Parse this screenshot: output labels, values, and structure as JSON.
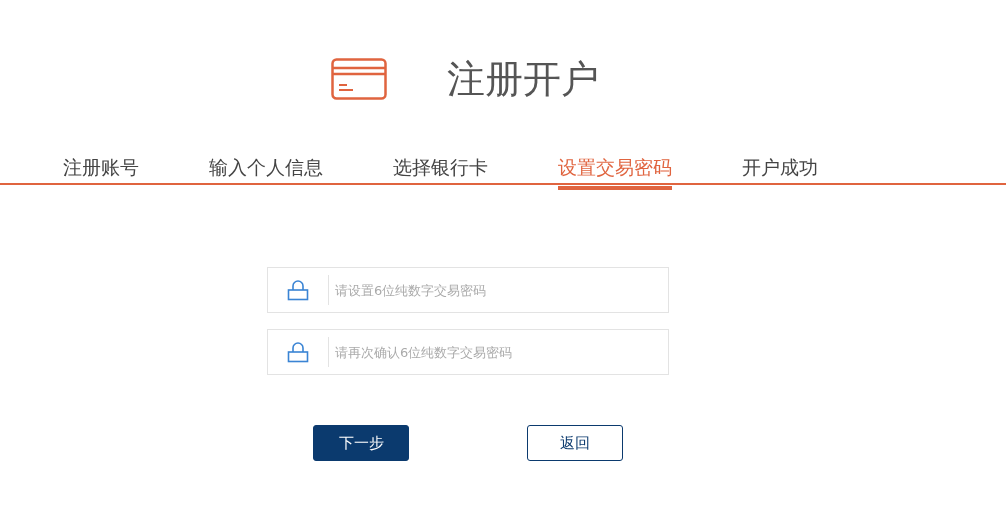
{
  "header": {
    "title": "注册开户"
  },
  "steps": [
    {
      "label": "注册账号",
      "selected": false
    },
    {
      "label": "输入个人信息",
      "selected": false
    },
    {
      "label": "选择银行卡",
      "selected": false
    },
    {
      "label": "设置交易密码",
      "selected": true
    },
    {
      "label": "开户成功",
      "selected": false
    }
  ],
  "fields": [
    {
      "placeholder": "请设置6位纯数字交易密码"
    },
    {
      "placeholder": "请再次确认6位纯数字交易密码"
    }
  ],
  "buttons": [
    {
      "label": "下一步",
      "kind": "primary"
    },
    {
      "label": "返回",
      "kind": "secondary"
    }
  ]
}
